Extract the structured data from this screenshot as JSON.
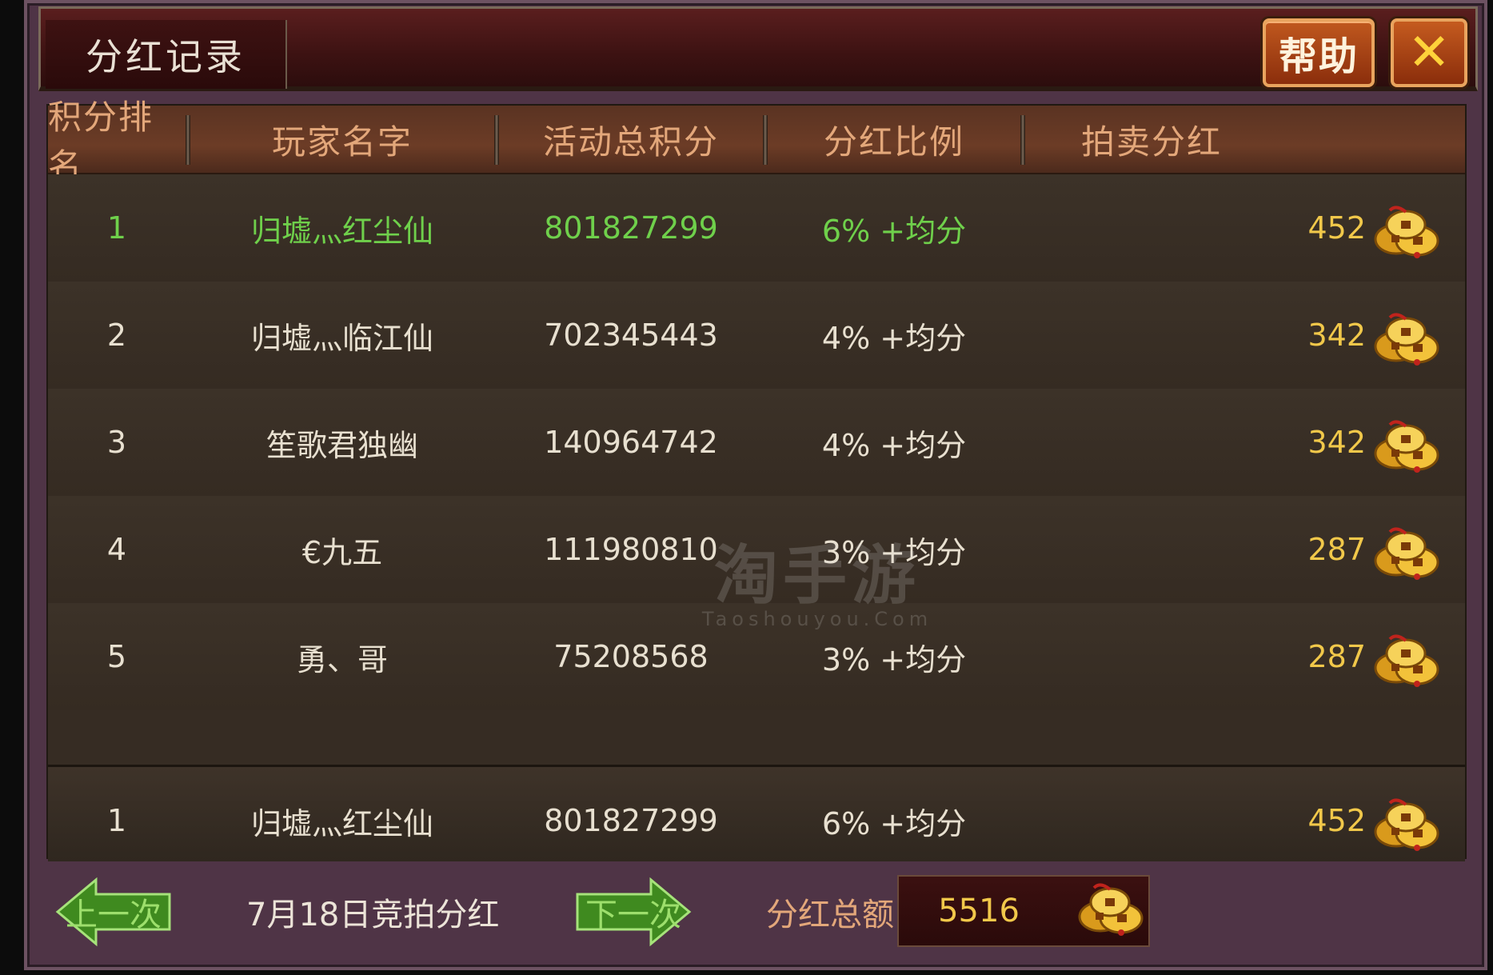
{
  "window": {
    "title": "分红记录",
    "help_label": "帮助",
    "close_label": "✕"
  },
  "table": {
    "headers": [
      "积分排名",
      "玩家名字",
      "活动总积分",
      "分红比例",
      "拍卖分红"
    ],
    "rows": [
      {
        "rank": "1",
        "name": "归墟灬红尘仙",
        "score": "801827299",
        "ratio": "6% +均分",
        "payout": "452",
        "self": true
      },
      {
        "rank": "2",
        "name": "归墟灬临江仙",
        "score": "702345443",
        "ratio": "4% +均分",
        "payout": "342",
        "self": false
      },
      {
        "rank": "3",
        "name": "笙歌君独幽",
        "score": "140964742",
        "ratio": "4% +均分",
        "payout": "342",
        "self": false
      },
      {
        "rank": "4",
        "name": "€九五",
        "score": "111980810",
        "ratio": "3% +均分",
        "payout": "287",
        "self": false
      },
      {
        "rank": "5",
        "name": "勇、哥",
        "score": "75208568",
        "ratio": "3% +均分",
        "payout": "287",
        "self": false
      }
    ],
    "my_row": {
      "rank": "1",
      "name": "归墟灬红尘仙",
      "score": "801827299",
      "ratio": "6% +均分",
      "payout": "452"
    }
  },
  "footer": {
    "prev_label": "上一次",
    "next_label": "下一次",
    "date_label": "7月18日竞拍分红",
    "total_label": "分红总额",
    "total_value": "5516"
  },
  "watermark": {
    "main": "淘手游",
    "sub": "Taoshouyou.Com"
  },
  "colors": {
    "highlight_green": "#6fd04b",
    "gold": "#f1c84a",
    "header_text": "#e3a77a"
  },
  "icons": {
    "currency": "gold-coins-icon"
  }
}
